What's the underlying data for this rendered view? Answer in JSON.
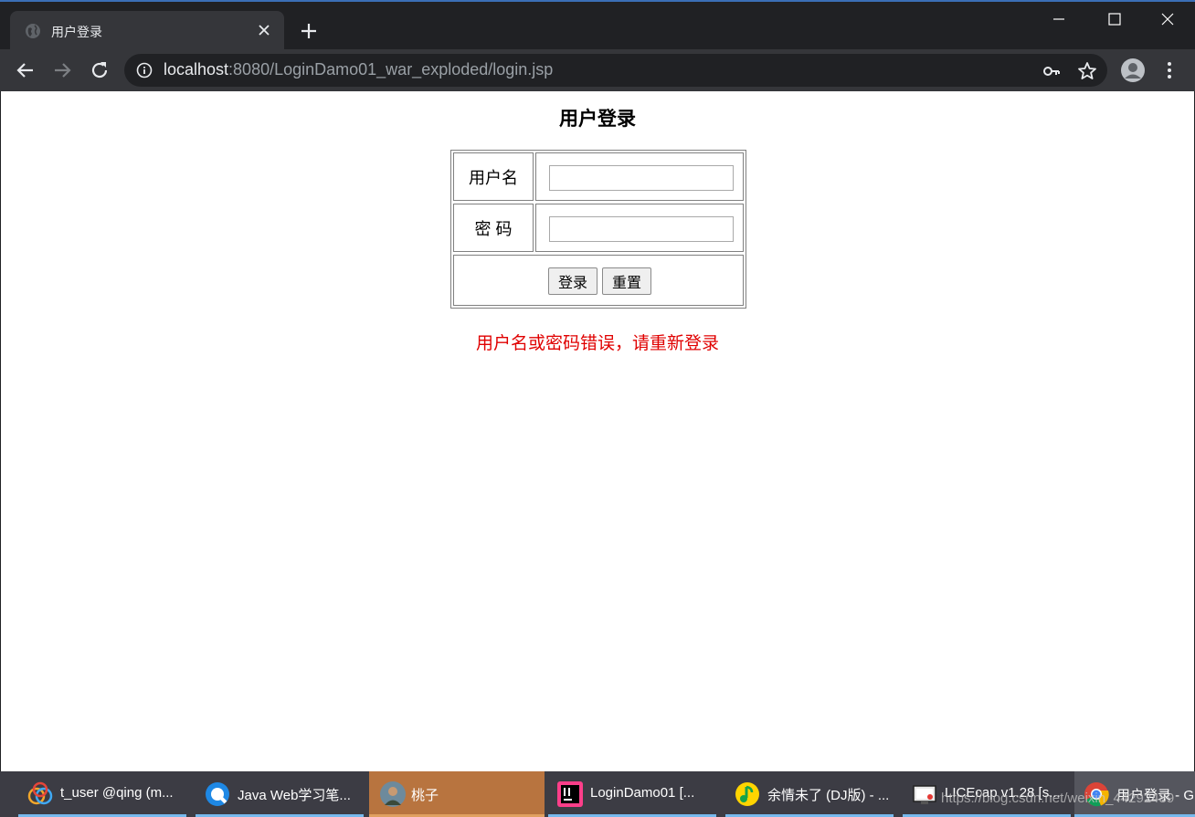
{
  "browser": {
    "tab_title": "用户登录",
    "url_host": "localhost",
    "url_rest": ":8080/LoginDamo01_war_exploded/login.jsp"
  },
  "page": {
    "title": "用户登录",
    "username_label": "用户名",
    "password_label": "密 码",
    "username_value": "",
    "password_value": "",
    "login_button": "登录",
    "reset_button": "重置",
    "error_message": "用户名或密码错误，请重新登录"
  },
  "taskbar": {
    "items": [
      {
        "label": "t_user @qing (m..."
      },
      {
        "label": "Java Web学习笔..."
      },
      {
        "label": "桃子"
      },
      {
        "label": "LoginDamo01 [..."
      },
      {
        "label": "余情未了 (DJ版) - ..."
      },
      {
        "label": "LICEcap v1.28 [s..."
      },
      {
        "label": "用户登录 - G"
      }
    ],
    "watermark": "https://blog.csdn.net/weixin_44292489"
  },
  "colors": {
    "chrome_dark": "#202124",
    "chrome_toolbar": "#35363a",
    "error_red": "#e00000",
    "taskbar_bg": "#3c3c44",
    "taskbar_active": "#b8743f",
    "taskbar_accent": "#76b9ed"
  }
}
